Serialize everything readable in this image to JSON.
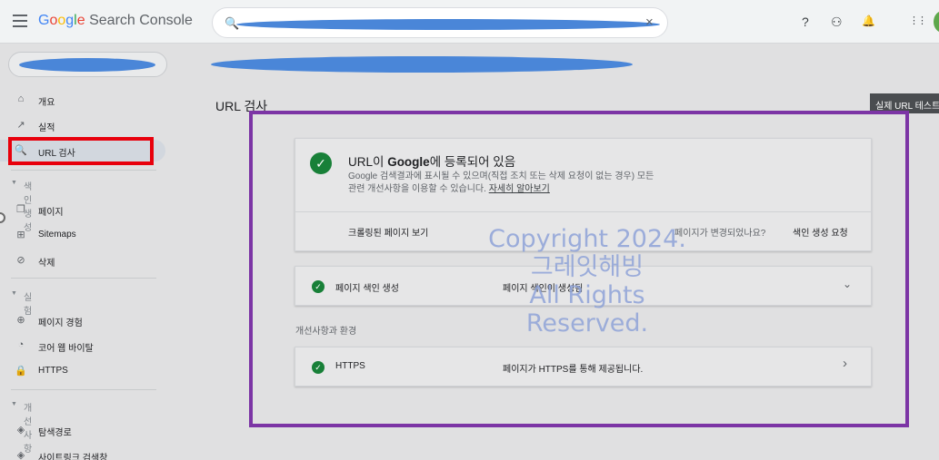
{
  "header": {
    "logo_google_letters": [
      "G",
      "o",
      "o",
      "g",
      "l",
      "e"
    ],
    "logo_product": "Search Console",
    "help_icon_glyph": "?",
    "users_icon_glyph": "⚇",
    "bell_icon_glyph": "🔔",
    "apps_icon_glyph": "⋮⋮",
    "search_icon_glyph": "🔍",
    "clear_icon_glyph": "×"
  },
  "sidebar": {
    "items": [
      {
        "label": "개요",
        "icon": "home-icon",
        "glyph": "⌂"
      },
      {
        "label": "실적",
        "icon": "trending-up-icon",
        "glyph": "↗"
      },
      {
        "label": "URL 검사",
        "icon": "search-icon",
        "glyph": "🔍"
      }
    ],
    "sections": [
      {
        "title": "색인생성",
        "items": [
          {
            "label": "페이지",
            "icon": "pages-icon",
            "glyph": "❐"
          },
          {
            "label": "Sitemaps",
            "icon": "sitemap-icon",
            "glyph": "⊞"
          },
          {
            "label": "삭제",
            "icon": "visibility-off-icon",
            "glyph": "⊘"
          }
        ]
      },
      {
        "title": "실험",
        "items": [
          {
            "label": "페이지 경험",
            "icon": "add-circle-icon",
            "glyph": "⊕"
          },
          {
            "label": "코어 웹 바이탈",
            "icon": "speed-icon",
            "glyph": "◔"
          },
          {
            "label": "HTTPS",
            "icon": "lock-icon",
            "glyph": "🔒"
          }
        ]
      },
      {
        "title": "개선사항",
        "items": [
          {
            "label": "탐색경로",
            "icon": "layers-icon",
            "glyph": "◈"
          },
          {
            "label": "사이트링크 검색창",
            "icon": "layers-icon",
            "glyph": "◈"
          }
        ]
      }
    ],
    "section_caret": "▼"
  },
  "main": {
    "title": "URL 검사",
    "live_test_button": "실제 URL 테스트",
    "status": {
      "title_prefix": "URL이 ",
      "title_bold": "Google",
      "title_suffix": "에 등록되어 있음",
      "description_line1": "Google 검색결과에 표시될 수 있으며(직접 조치 또는 삭제 요청이 없는 경우) 모든",
      "description_line2": "관련 개선사항을 이용할 수 있습니다.",
      "learn_more": "자세히 알아보기",
      "check_glyph": "✓"
    },
    "crawled_page_link": "크롤링된 페이지 보기",
    "page_changed_question": "페이지가 변경되었나요?",
    "request_indexing": "색인 생성 요청",
    "indexing_row": {
      "label": "페이지 색인 생성",
      "value": "페이지 색인이 생성됨",
      "chevron": "⌄"
    },
    "enhancements_label": "개선사항과 환경",
    "https_row": {
      "label": "HTTPS",
      "value": "페이지가 HTTPS를 통해 제공됩니다.",
      "chevron": "›"
    }
  },
  "watermark": {
    "line1": "Copyright 2024.",
    "line2": "그레잇해빙",
    "line3": "All Rights Reserved."
  },
  "colors": {
    "success_green": "#188038",
    "highlight_red": "#e8000c",
    "frame_purple": "#7c35a5",
    "redaction_blue": "#4a86d8"
  }
}
